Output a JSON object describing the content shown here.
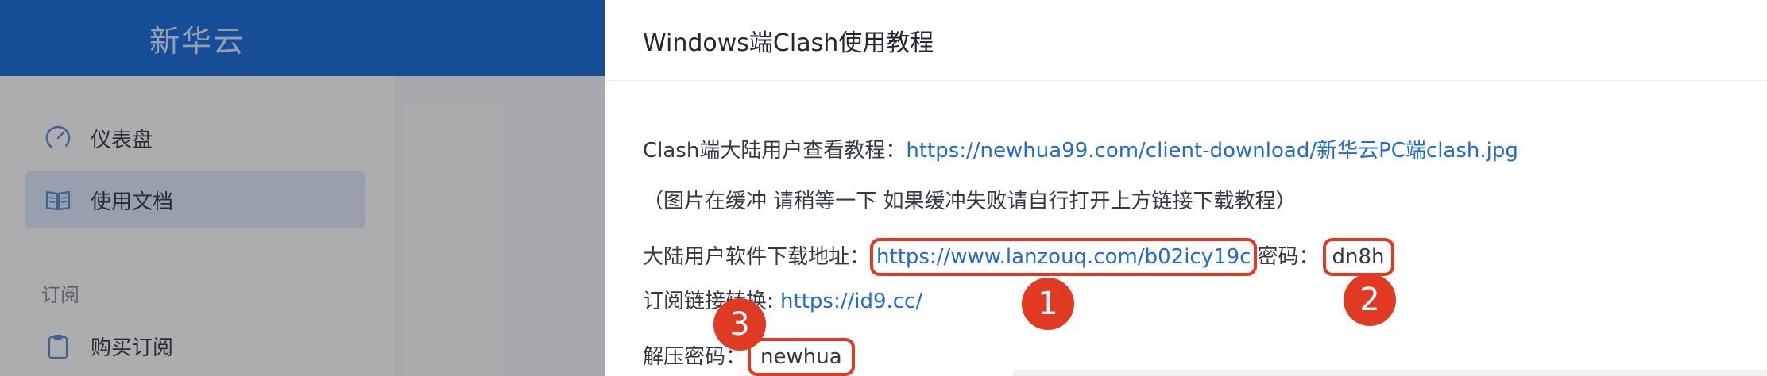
{
  "app": {
    "brand": "新华云",
    "header_color": "#1f6fd9"
  },
  "sidebar": {
    "items": [
      {
        "label": "仪表盘",
        "icon": "dashboard-icon",
        "active": false
      },
      {
        "label": "使用文档",
        "icon": "book-icon",
        "active": true
      }
    ],
    "section_label": "订阅",
    "section_items": [
      {
        "label": "购买订阅",
        "icon": "clipboard-icon"
      }
    ]
  },
  "drawer": {
    "title": "Windows端Clash使用教程",
    "line1_label": "Clash端大陆用户查看教程：",
    "line1_link": "https://newhua99.com/client-download/新华云PC端clash.jpg",
    "line2_text": "（图片在缓冲 请稍等一下 如果缓冲失败请自行打开上方链接下载教程）",
    "line3_label": "大陆用户软件下载地址：",
    "line3_link": "https://www.lanzouq.com/b02icy19c",
    "line3_pw_label": "密码：",
    "line3_pw": "dn8h",
    "line4_label": "订阅链接转换: ",
    "line4_link": "https://id9.cc/",
    "line5_label": "解压密码：",
    "line5_pw": "newhua"
  },
  "annotations": {
    "color": "#e13a22",
    "badges": [
      "1",
      "2",
      "3"
    ]
  }
}
